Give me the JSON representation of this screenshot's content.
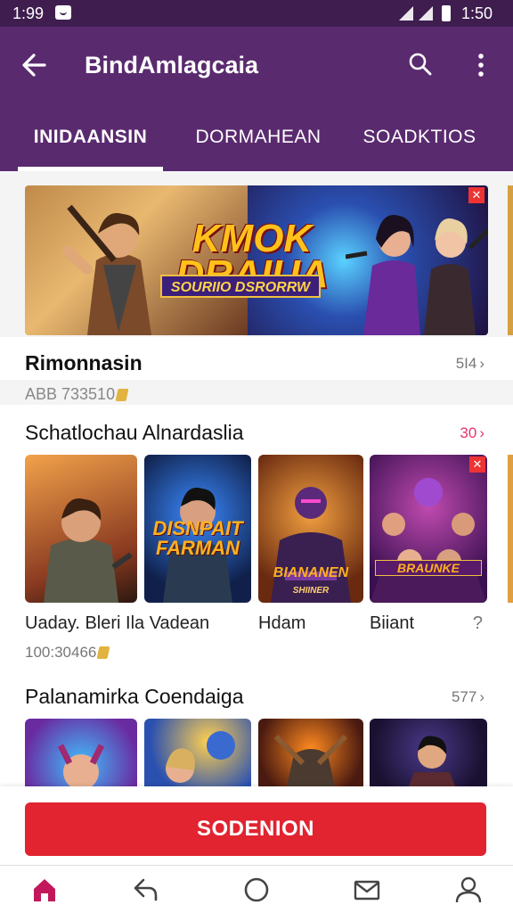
{
  "status_bar": {
    "time": "1:99",
    "clock": "1:50"
  },
  "app_bar": {
    "title": "BindAmlagcaia"
  },
  "tabs": [
    {
      "label": "INIDAANSIN",
      "active": true
    },
    {
      "label": "DORMAHEAN",
      "active": false
    },
    {
      "label": "SOADKTIOS",
      "active": false
    }
  ],
  "banner": {
    "title": "KMOK DRAIUA",
    "subtitle": "SOURIIO DSRORRW"
  },
  "section1": {
    "title": "Rimonnasin",
    "count": "5I4",
    "meta": "ABB 733510"
  },
  "section2": {
    "title": "Schatlochau Alnardaslia",
    "count": "30",
    "cards": [
      {
        "label": "",
        "name": "Uaday. Bleri Ila Vadean"
      },
      {
        "label": "DISNPAIT FARMAN",
        "name": ""
      },
      {
        "label": "BIANANEN",
        "sublabel": "SHIINER",
        "name": "Hdam"
      },
      {
        "label": "BRAUNKE",
        "name": "Biiant"
      }
    ],
    "meta": "100:30466"
  },
  "section3": {
    "title": "Palanamirka Coendaiga",
    "count": "577"
  },
  "cta": {
    "label": "SODENION"
  },
  "bottom_nav": [
    {
      "icon": "home-icon",
      "label": ""
    },
    {
      "icon": "share-icon",
      "label": ""
    },
    {
      "icon": "circle-icon",
      "label": ""
    },
    {
      "icon": "mail-icon",
      "label": ""
    },
    {
      "icon": "profile-icon",
      "label": ""
    }
  ],
  "colors": {
    "primary": "#5a2a6f",
    "status": "#3f1e4f",
    "accent": "#e12430",
    "pink": "#e2366b"
  }
}
